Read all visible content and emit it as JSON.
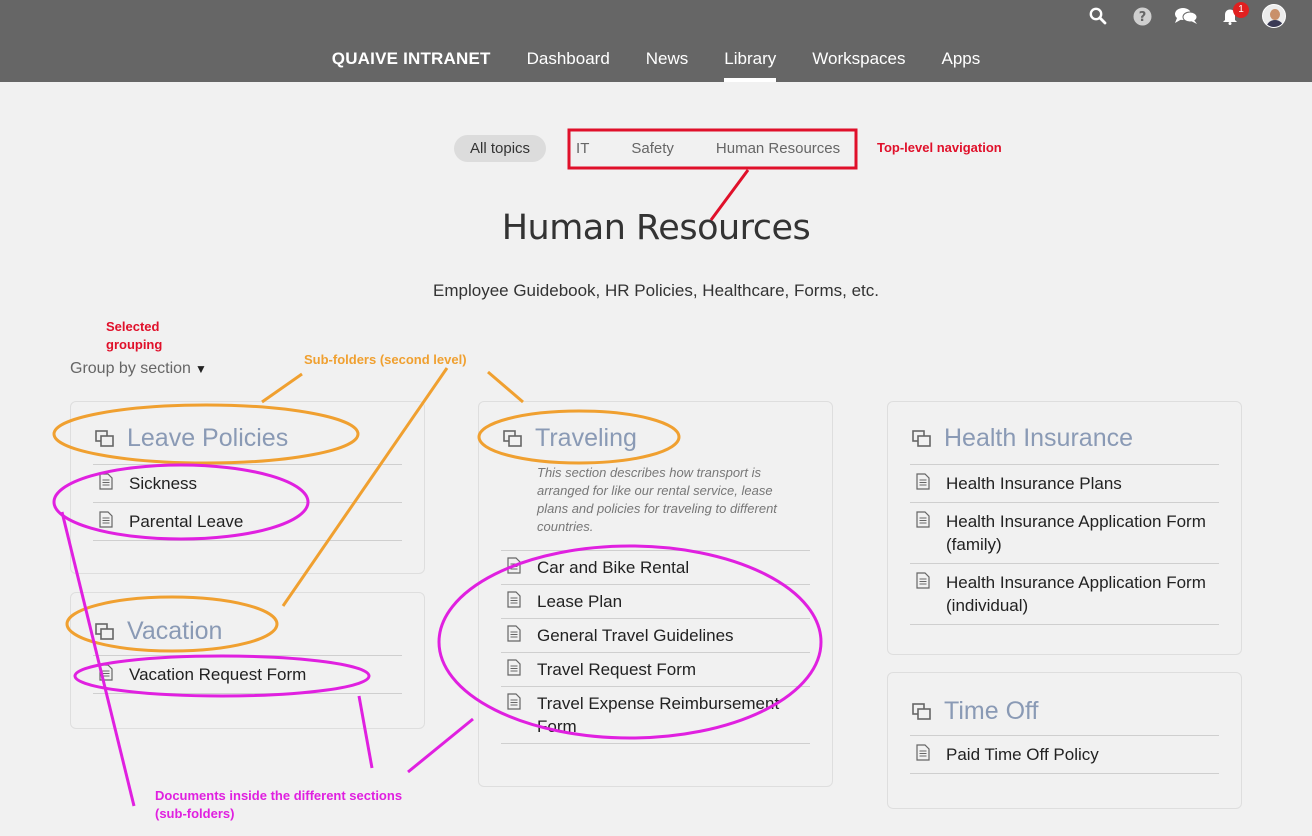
{
  "header": {
    "brand": "QUAIVE INTRANET",
    "nav": [
      "Dashboard",
      "News",
      "Library",
      "Workspaces",
      "Apps"
    ],
    "active_nav": "Library",
    "notification_count": "1",
    "icons": [
      "search-icon",
      "help-icon",
      "chat-icon",
      "notifications-icon",
      "avatar"
    ]
  },
  "topics": {
    "all_label": "All topics",
    "items": [
      "IT",
      "Safety",
      "Human Resources"
    ]
  },
  "page": {
    "title": "Human Resources",
    "description": "Employee Guidebook, HR Policies, Healthcare, Forms, etc."
  },
  "grouping": {
    "label": "Group by section",
    "caret": "▼"
  },
  "sections": {
    "leave": {
      "title": "Leave Policies",
      "docs": [
        "Sickness",
        "Parental Leave"
      ]
    },
    "vacation": {
      "title": "Vacation",
      "docs": [
        "Vacation Request Form"
      ]
    },
    "traveling": {
      "title": "Traveling",
      "description": "This section describes how transport is arranged for like our rental service, lease plans and policies for traveling to different countries.",
      "docs": [
        "Car and Bike Rental",
        "Lease Plan",
        "General Travel Guidelines",
        "Travel Request Form",
        "Travel Expense Reimbursement Form"
      ]
    },
    "health": {
      "title": "Health Insurance",
      "docs": [
        "Health Insurance Plans",
        "Health Insurance Application Form (family)",
        "Health Insurance Application Form (individual)"
      ]
    },
    "timeoff": {
      "title": "Time Off",
      "docs": [
        "Paid Time Off Policy"
      ]
    }
  },
  "annotations": {
    "top_level": "Top-level navigation",
    "selected_grouping_1": "Selected",
    "selected_grouping_2": "grouping",
    "subfolders": "Sub-folders (second level)",
    "documents_1": "Documents inside the different sections",
    "documents_2": "(sub-folders)"
  },
  "colors": {
    "topbar": "#666666",
    "background": "#f1f1f1",
    "section_title": "#8a9ab5",
    "annotation_red": "#e0102a",
    "annotation_orange": "#f0a030",
    "annotation_magenta": "#e020e0"
  }
}
